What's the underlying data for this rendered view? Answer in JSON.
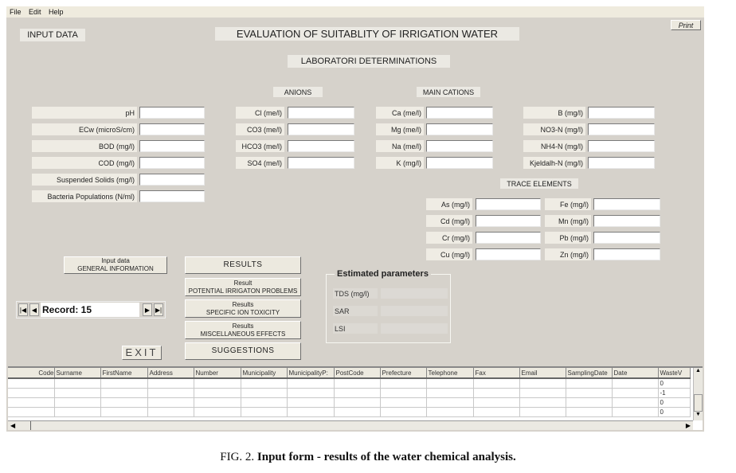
{
  "menu": [
    "File",
    "Edit",
    "Help"
  ],
  "header": {
    "input_data": "INPUT DATA",
    "title": "EVALUATION OF SUITABLITY OF IRRIGATION WATER",
    "subtitle": "LABORATORI DETERMINATIONS",
    "print_label": "Print"
  },
  "sections": {
    "anions": "ANIONS",
    "main_cations": "MAIN CATIONS",
    "trace_elements": "TRACE ELEMENTS"
  },
  "general_fields": [
    {
      "label": "pH",
      "value": ""
    },
    {
      "label": "ECw (microS/cm)",
      "value": ""
    },
    {
      "label": "BOD (mg/l)",
      "value": ""
    },
    {
      "label": "COD (mg/l)",
      "value": ""
    },
    {
      "label": "Suspended Solids (mg/l)",
      "value": ""
    },
    {
      "label": "Bacteria Populations (N/ml)",
      "value": ""
    }
  ],
  "anion_fields": [
    {
      "label": "Cl (me/l)",
      "value": ""
    },
    {
      "label": "CO3 (me/l)",
      "value": ""
    },
    {
      "label": "HCO3 (me/l)",
      "value": ""
    },
    {
      "label": "SO4 (me/l)",
      "value": ""
    }
  ],
  "cation_fields": [
    {
      "label": "Ca (me/l)",
      "value": ""
    },
    {
      "label": "Mg (me/l)",
      "value": ""
    },
    {
      "label": "Na (me/l)",
      "value": ""
    },
    {
      "label": "K (mg/l)",
      "value": ""
    }
  ],
  "nutrient_fields": [
    {
      "label": "B (mg/l)",
      "value": ""
    },
    {
      "label": "NO3-N (mg/l)",
      "value": ""
    },
    {
      "label": "NH4-N (mg/l)",
      "value": ""
    },
    {
      "label": "Kjeldalh-N (mg/l)",
      "value": ""
    }
  ],
  "trace_left": [
    {
      "label": "As (mg/l)",
      "value": ""
    },
    {
      "label": "Cd (mg/l)",
      "value": ""
    },
    {
      "label": "Cr (mg/l)",
      "value": ""
    },
    {
      "label": "Cu (mg/l)",
      "value": ""
    }
  ],
  "trace_right": [
    {
      "label": "Fe (mg/l)",
      "value": ""
    },
    {
      "label": "Mn (mg/l)",
      "value": ""
    },
    {
      "label": "Pb (mg/l)",
      "value": ""
    },
    {
      "label": "Zn (mg/l)",
      "value": ""
    }
  ],
  "buttons": {
    "general_info_line1": "Input data",
    "general_info_line2": "GENERAL INFORMATION",
    "results": "RESULTS",
    "potential_line1": "Result",
    "potential_line2": "POTENTIAL IRRIGATON PROBLEMS",
    "toxicity_line1": "Results",
    "toxicity_line2": "SPECIFIC ION TOXICITY",
    "misc_line1": "Results",
    "misc_line2": "MISCELLANEOUS EFFECTS",
    "suggestions": "SUGGESTIONS",
    "exit": "EXIT"
  },
  "estimated": {
    "title": "Estimated parameters",
    "rows": [
      {
        "label": "TDS (mg/l)",
        "value": ""
      },
      {
        "label": "SAR",
        "value": ""
      },
      {
        "label": "LSI",
        "value": ""
      }
    ]
  },
  "record_nav": {
    "label": "Record: 15",
    "first": "|◀",
    "prev": "◀",
    "next": "▶",
    "last": "▶|"
  },
  "grid": {
    "columns": [
      "Code",
      "Surname",
      "FirstName",
      "Address",
      "Number",
      "Municipality",
      "MunicipalityP:",
      "PostCode",
      "Prefecture",
      "Telephone",
      "Fax",
      "Email",
      "SamplingDate",
      "Date",
      "WasteV"
    ],
    "rows": [
      [
        "",
        "",
        "",
        "",
        "",
        "",
        "",
        "",
        "",
        "",
        "",
        "",
        "",
        "",
        "0"
      ],
      [
        "",
        "",
        "",
        "",
        "",
        "",
        "",
        "",
        "",
        "",
        "",
        "",
        "",
        "",
        "-1"
      ],
      [
        "",
        "",
        "",
        "",
        "",
        "",
        "",
        "",
        "",
        "",
        "",
        "",
        "",
        "",
        "0"
      ],
      [
        "",
        "",
        "",
        "",
        "",
        "",
        "",
        "",
        "",
        "",
        "",
        "",
        "",
        "",
        "0"
      ]
    ]
  },
  "caption": {
    "prefix": "FIG. 2.",
    "text": "Input form - results of the water chemical analysis."
  }
}
